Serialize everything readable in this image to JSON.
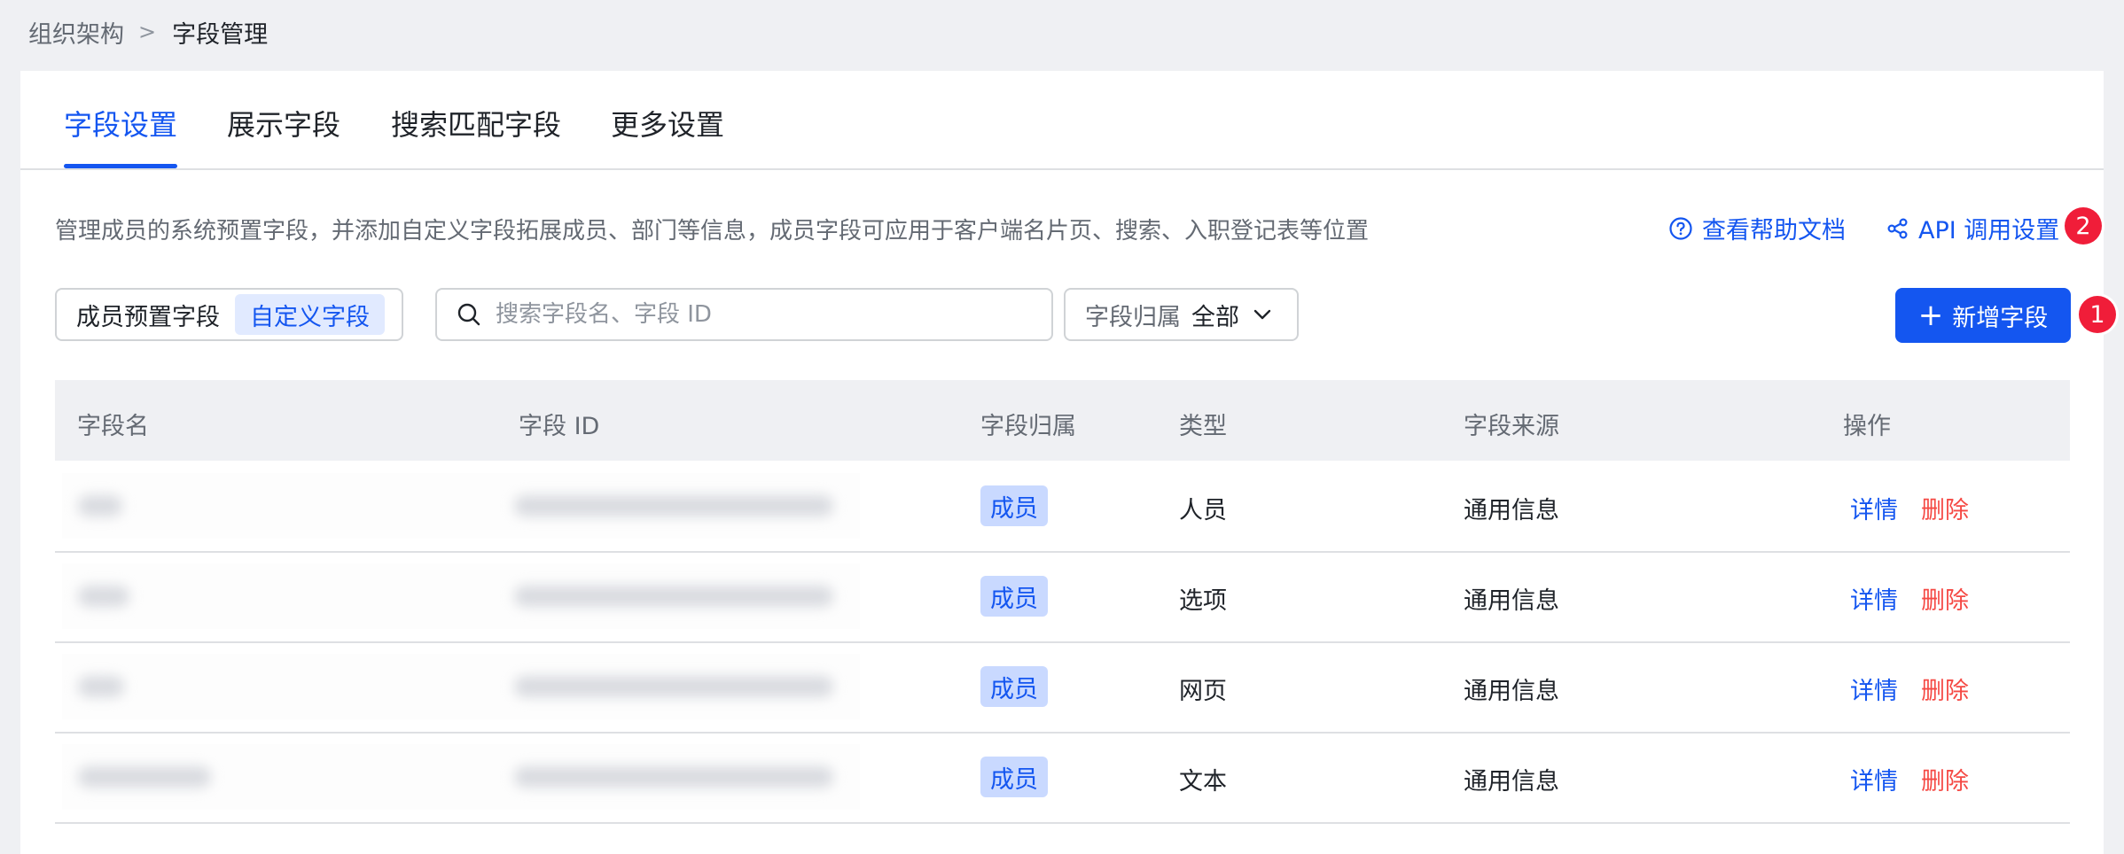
{
  "breadcrumb": {
    "parent": "组织架构",
    "separator": ">",
    "current": "字段管理"
  },
  "tabs": [
    "字段设置",
    "展示字段",
    "搜索匹配字段",
    "更多设置"
  ],
  "active_tab": "字段设置",
  "description": "管理成员的系统预置字段，并添加自定义字段拓展成员、部门等信息，成员字段可应用于客户端名片页、搜索、入职登记表等位置",
  "help_link": "查看帮助文档",
  "api_link": "API 调用设置",
  "markers": {
    "api": "2",
    "add": "1"
  },
  "segmented": {
    "options": [
      "成员预置字段",
      "自定义字段"
    ],
    "selected": "自定义字段"
  },
  "search": {
    "placeholder": "搜索字段名、字段 ID",
    "value": ""
  },
  "filter": {
    "label": "字段归属",
    "value": "全部"
  },
  "add_button": "新增字段",
  "table": {
    "headers": [
      "字段名",
      "字段 ID",
      "字段归属",
      "类型",
      "字段来源",
      "操作"
    ],
    "rows": [
      {
        "belong": "成员",
        "type": "人员",
        "source": "通用信息",
        "detail": "详情",
        "delete": "删除"
      },
      {
        "belong": "成员",
        "type": "选项",
        "source": "通用信息",
        "detail": "详情",
        "delete": "删除"
      },
      {
        "belong": "成员",
        "type": "网页",
        "source": "通用信息",
        "detail": "详情",
        "delete": "删除"
      },
      {
        "belong": "成员",
        "type": "文本",
        "source": "通用信息",
        "detail": "详情",
        "delete": "删除"
      }
    ]
  },
  "colors": {
    "primary": "#1456f0",
    "danger": "#f54a45",
    "marker": "#f01d39",
    "tag_bg": "#c9d9ff"
  }
}
